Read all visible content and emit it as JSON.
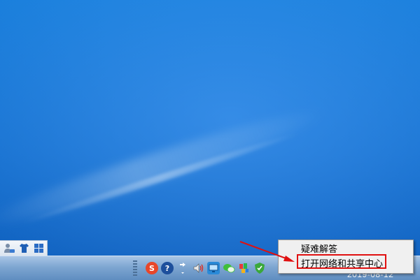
{
  "desktop": {
    "background_color": "#1670cf"
  },
  "quick_toolbar": {
    "icons": [
      "user-swap-icon",
      "tshirt-icon",
      "grid-apps-icon"
    ]
  },
  "tray": {
    "icons": [
      "sogou-input-icon",
      "help-icon",
      "network-arrows-icon",
      "speaker-icon",
      "monitor-icon",
      "wechat-icon",
      "colorful-app-icon",
      "security-shield-icon"
    ]
  },
  "clock": {
    "date": "2019-08-12"
  },
  "context_menu": {
    "items": [
      {
        "label": "疑难解答"
      },
      {
        "label": "打开网络和共享中心"
      }
    ]
  },
  "annotation": {
    "color": "#e01010"
  }
}
